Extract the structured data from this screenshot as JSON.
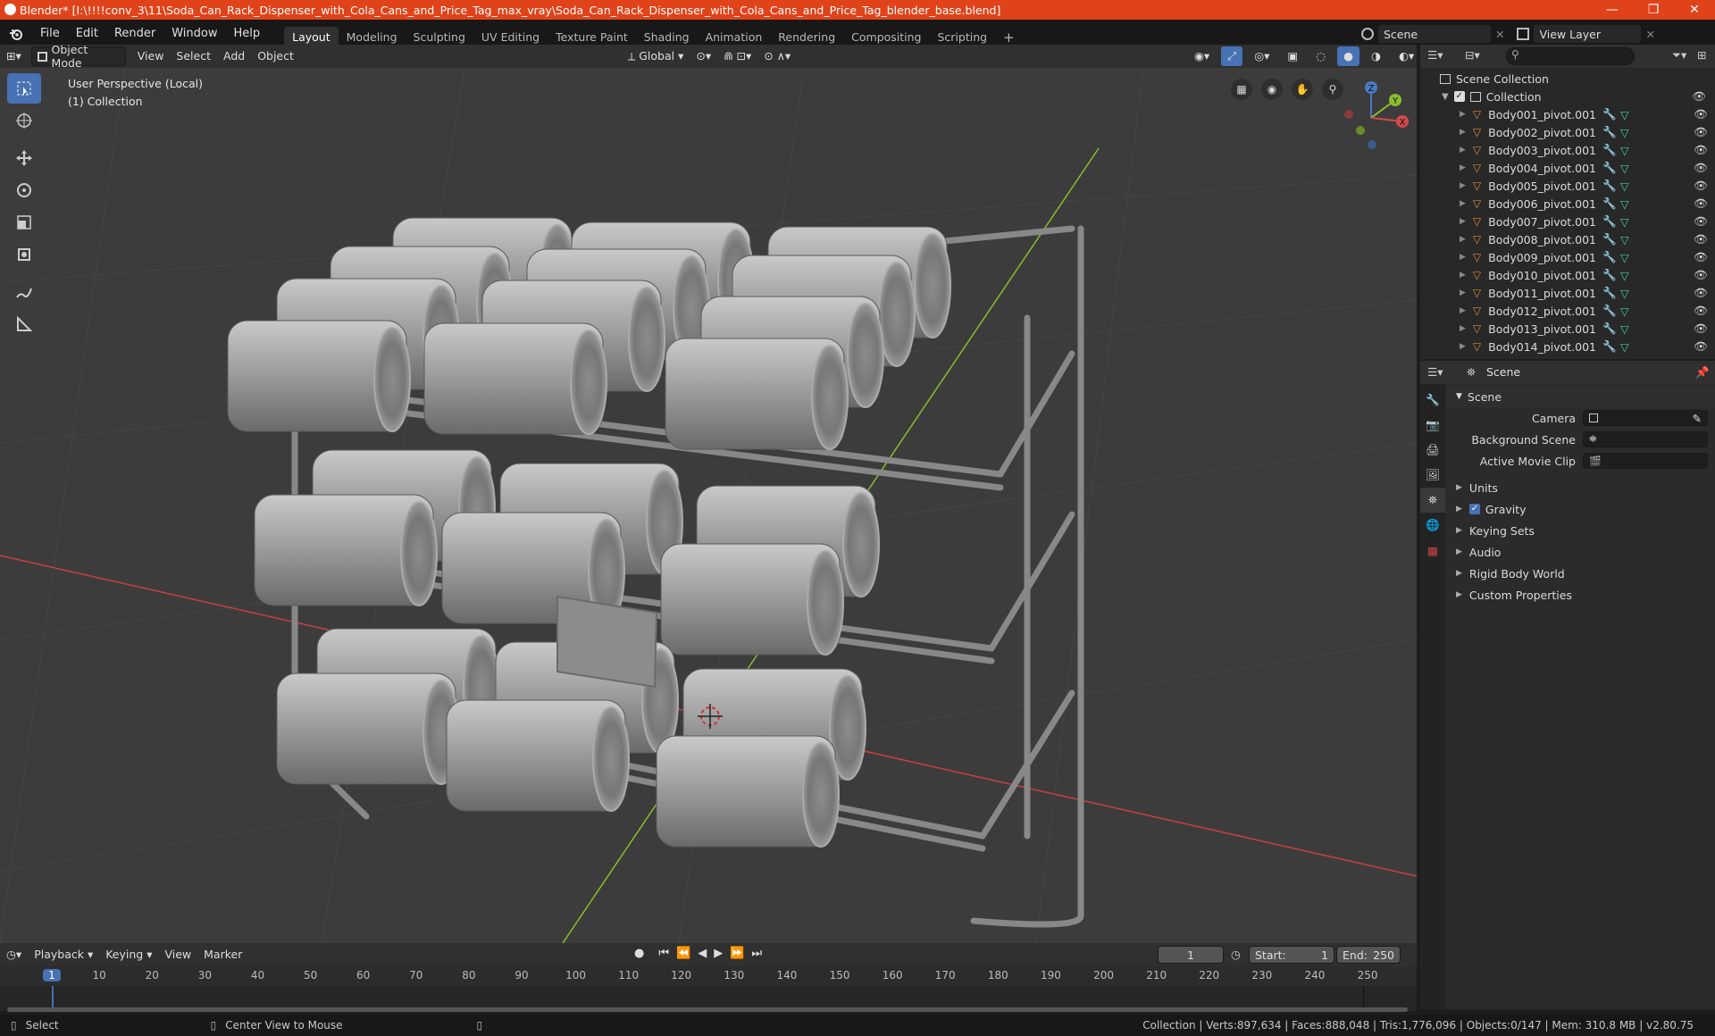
{
  "window": {
    "title": "Blender* [I:\\!!!!conv_3\\11\\Soda_Can_Rack_Dispenser_with_Cola_Cans_and_Price_Tag_max_vray\\Soda_Can_Rack_Dispenser_with_Cola_Cans_and_Price_Tag_blender_base.blend]",
    "minimize": "—",
    "maximize": "❐",
    "close": "✕",
    "titlebar_color": "#e0431a"
  },
  "menu": [
    "File",
    "Edit",
    "Render",
    "Window",
    "Help"
  ],
  "workspaces": {
    "tabs": [
      "Layout",
      "Modeling",
      "Sculpting",
      "UV Editing",
      "Texture Paint",
      "Shading",
      "Animation",
      "Rendering",
      "Compositing",
      "Scripting"
    ],
    "active": "Layout",
    "add": "+"
  },
  "scene_selector": {
    "value": "Scene"
  },
  "view_layer_selector": {
    "value": "View Layer"
  },
  "viewport_header": {
    "mode": "Object Mode",
    "view": "View",
    "select": "Select",
    "add": "Add",
    "object": "Object",
    "orientation": "Global"
  },
  "viewport": {
    "perspective_label": "User Perspective (Local)",
    "collection_label": "(1) Collection",
    "gizmo": {
      "z": "Z",
      "y": "Y",
      "x": "X"
    },
    "axis_x_color": "#c84040",
    "axis_y_color": "#8cbc2c"
  },
  "outliner": {
    "search_placeholder": "",
    "scene_collection": "Scene Collection",
    "collection": "Collection",
    "items": [
      "Body001_pivot.001",
      "Body002_pivot.001",
      "Body003_pivot.001",
      "Body004_pivot.001",
      "Body005_pivot.001",
      "Body006_pivot.001",
      "Body007_pivot.001",
      "Body008_pivot.001",
      "Body009_pivot.001",
      "Body010_pivot.001",
      "Body011_pivot.001",
      "Body012_pivot.001",
      "Body013_pivot.001",
      "Body014_pivot.001"
    ]
  },
  "properties": {
    "header": "Scene",
    "section": "Scene",
    "camera_label": "Camera",
    "background_scene_label": "Background Scene",
    "active_movie_clip_label": "Active Movie Clip",
    "subsections": [
      "Units",
      "Gravity",
      "Keying Sets",
      "Audio",
      "Rigid Body World",
      "Custom Properties"
    ],
    "gravity_checked": true
  },
  "timeline": {
    "playback": "Playback",
    "keying": "Keying",
    "view": "View",
    "marker": "Marker",
    "current_frame": "1",
    "start_label": "Start:",
    "start": "1",
    "end_label": "End:",
    "end": "250",
    "ticks": [
      "1",
      "10",
      "20",
      "30",
      "40",
      "50",
      "60",
      "70",
      "80",
      "90",
      "100",
      "110",
      "120",
      "130",
      "140",
      "150",
      "160",
      "170",
      "180",
      "190",
      "200",
      "210",
      "220",
      "230",
      "240",
      "250"
    ]
  },
  "statusbar": {
    "select": "Select",
    "center_view": "Center View to Mouse",
    "stats": "Collection | Verts:897,634 | Faces:888,048 | Tris:1,776,096 | Objects:0/147 | Mem: 310.8 MB | v2.80.75"
  }
}
